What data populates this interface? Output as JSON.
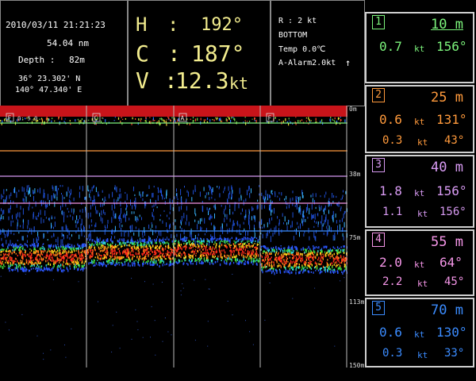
{
  "info": {
    "datetime": "2010/03/11 21:21:23",
    "distance": "54.04 nm",
    "depth_label": "Depth :",
    "depth_value": "82m",
    "lat": "36° 23.302' N",
    "lon": "140° 47.340' E"
  },
  "hcv": {
    "h_label": "H",
    "h_value": "192°",
    "c_label": "C",
    "c_value": "187°",
    "v_label": "V",
    "v_value": "12.3",
    "v_unit": "kt",
    "sep": ":"
  },
  "status": {
    "range": "R : 2 kt",
    "mode": "BOTTOM",
    "temp": "Temp 0.0℃",
    "alarm": "A-Alarm2.0kt",
    "alarm_arrow": "↑"
  },
  "echo": {
    "marker_text": "0: 5.0",
    "marker_letters": [
      "F",
      "C",
      "A",
      "F"
    ],
    "depth_labels": [
      "0m",
      "38m",
      "75m",
      "113m",
      "150m"
    ]
  },
  "layers": [
    {
      "num": "1",
      "depth": "10 m",
      "speed": "0.7",
      "unit": "kt",
      "dir": "156°",
      "color": "#7cf47c",
      "speed2": "",
      "unit2": "",
      "dir2": ""
    },
    {
      "num": "2",
      "depth": "25 m",
      "speed": "0.6",
      "unit": "kt",
      "dir": "131°",
      "color": "#ff9a3c",
      "speed2": "0.3",
      "unit2": "kt",
      "dir2": "43°"
    },
    {
      "num": "3",
      "depth": "40 m",
      "speed": "1.8",
      "unit": "kt",
      "dir": "156°",
      "color": "#d79af2",
      "speed2": "1.1",
      "unit2": "kt",
      "dir2": "156°"
    },
    {
      "num": "4",
      "depth": "55 m",
      "speed": "2.0",
      "unit": "kt",
      "dir": "64°",
      "color": "#f596e8",
      "speed2": "2.2",
      "unit2": "kt",
      "dir2": "45°"
    },
    {
      "num": "5",
      "depth": "70 m",
      "speed": "0.6",
      "unit": "kt",
      "dir": "130°",
      "color": "#3b8cff",
      "speed2": "0.3",
      "unit2": "kt",
      "dir2": "33°"
    }
  ]
}
